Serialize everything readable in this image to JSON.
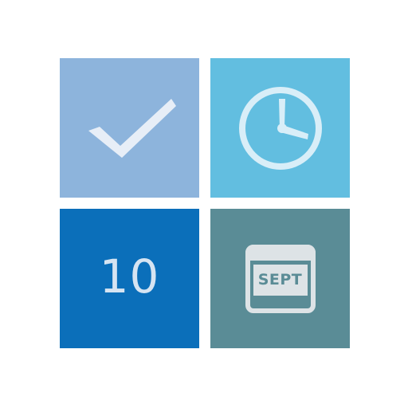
{
  "tiles": {
    "tasks": {
      "icon": "checkmark-icon",
      "color": "#8db4dc",
      "icon_color": "#e7eef7"
    },
    "clock": {
      "icon": "clock-icon",
      "color": "#62bee0",
      "icon_color": "#d8eef8"
    },
    "day": {
      "value": "10",
      "color": "#0b6fba",
      "text_color": "#d6e4f2"
    },
    "month": {
      "label": "SEPT",
      "icon": "calendar-icon",
      "color": "#5a8c96",
      "icon_color": "#dde3e6"
    }
  }
}
